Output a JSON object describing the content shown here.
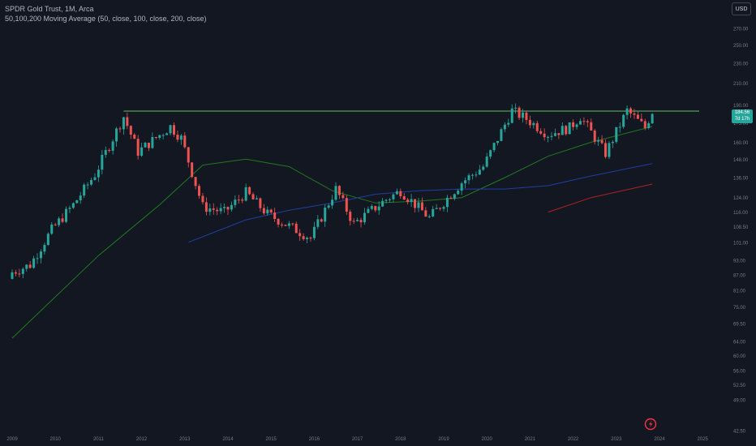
{
  "legend": {
    "title": "SPDR Gold Trust, 1M, Arca",
    "indicator": "50,100,200 Moving Average (50, close, 100, close, 200, close)"
  },
  "currency_button": "USD",
  "current_price": {
    "value": "184.56",
    "countdown": "7d 17h"
  },
  "colors": {
    "background": "#131722",
    "up": "#26a69a",
    "down": "#ef5350",
    "ma50": "#1e7b1e",
    "ma100": "#1e3fa0",
    "ma200": "#b22222",
    "resistance": "#66bb6a",
    "axis_text": "#787b86"
  },
  "logo_icon": "tradingview-logo-icon",
  "chart_data": {
    "type": "candlestick",
    "title": "SPDR Gold Trust, 1M, Arca",
    "x_axis": {
      "ticks": [
        "2009",
        "2010",
        "2011",
        "2012",
        "2013",
        "2014",
        "2015",
        "2016",
        "2017",
        "2018",
        "2019",
        "2020",
        "2021",
        "2022",
        "2023",
        "2024",
        "2025"
      ]
    },
    "y_axis": {
      "scale": "log",
      "position": "right",
      "ticks": [
        "270.00",
        "250.00",
        "230.00",
        "210.00",
        "190.00",
        "175.00",
        "160.00",
        "148.00",
        "136.00",
        "124.00",
        "116.00",
        "108.50",
        "101.00",
        "93.00",
        "87.00",
        "81.00",
        "75.00",
        "69.50",
        "64.00",
        "60.00",
        "56.00",
        "52.50",
        "49.00",
        "42.50"
      ]
    },
    "resistance_level": 184.56,
    "candles_monthly_close_approx": [
      {
        "date": "2009-01",
        "close": 88
      },
      {
        "date": "2009-06",
        "close": 91
      },
      {
        "date": "2009-12",
        "close": 107
      },
      {
        "date": "2010-06",
        "close": 120
      },
      {
        "date": "2010-12",
        "close": 138
      },
      {
        "date": "2011-08",
        "close": 180
      },
      {
        "date": "2011-12",
        "close": 153
      },
      {
        "date": "2012-09",
        "close": 172
      },
      {
        "date": "2012-12",
        "close": 163
      },
      {
        "date": "2013-06",
        "close": 119
      },
      {
        "date": "2013-12",
        "close": 116
      },
      {
        "date": "2014-06",
        "close": 127
      },
      {
        "date": "2014-12",
        "close": 115
      },
      {
        "date": "2015-12",
        "close": 103
      },
      {
        "date": "2016-07",
        "close": 129
      },
      {
        "date": "2016-12",
        "close": 110
      },
      {
        "date": "2017-09",
        "close": 123
      },
      {
        "date": "2018-01",
        "close": 128
      },
      {
        "date": "2018-09",
        "close": 113
      },
      {
        "date": "2019-06",
        "close": 133
      },
      {
        "date": "2019-12",
        "close": 143
      },
      {
        "date": "2020-08",
        "close": 185
      },
      {
        "date": "2020-12",
        "close": 178
      },
      {
        "date": "2021-06",
        "close": 166
      },
      {
        "date": "2021-12",
        "close": 171
      },
      {
        "date": "2022-03",
        "close": 180
      },
      {
        "date": "2022-10",
        "close": 152
      },
      {
        "date": "2023-04",
        "close": 185
      },
      {
        "date": "2023-09",
        "close": 171
      },
      {
        "date": "2023-11",
        "close": 184.56
      }
    ],
    "series": [
      {
        "name": "MA 50",
        "values_approx": [
          {
            "date": "2009-01",
            "v": 65
          },
          {
            "date": "2011-01",
            "v": 95
          },
          {
            "date": "2012-06",
            "v": 120
          },
          {
            "date": "2013-06",
            "v": 144
          },
          {
            "date": "2014-06",
            "v": 148
          },
          {
            "date": "2015-06",
            "v": 143
          },
          {
            "date": "2016-06",
            "v": 128
          },
          {
            "date": "2017-06",
            "v": 121
          },
          {
            "date": "2018-06",
            "v": 122
          },
          {
            "date": "2019-06",
            "v": 124
          },
          {
            "date": "2020-06",
            "v": 136
          },
          {
            "date": "2021-06",
            "v": 150
          },
          {
            "date": "2022-06",
            "v": 160
          },
          {
            "date": "2023-11",
            "v": 172
          }
        ]
      },
      {
        "name": "MA 100",
        "values_approx": [
          {
            "date": "2013-02",
            "v": 101
          },
          {
            "date": "2014-06",
            "v": 112
          },
          {
            "date": "2015-06",
            "v": 117
          },
          {
            "date": "2016-06",
            "v": 121
          },
          {
            "date": "2017-06",
            "v": 126
          },
          {
            "date": "2018-06",
            "v": 128
          },
          {
            "date": "2019-06",
            "v": 129
          },
          {
            "date": "2020-06",
            "v": 129
          },
          {
            "date": "2021-06",
            "v": 131
          },
          {
            "date": "2022-06",
            "v": 137
          },
          {
            "date": "2023-11",
            "v": 145
          }
        ]
      },
      {
        "name": "MA 200",
        "values_approx": [
          {
            "date": "2021-06",
            "v": 116
          },
          {
            "date": "2022-06",
            "v": 124
          },
          {
            "date": "2023-11",
            "v": 132
          }
        ]
      }
    ]
  }
}
